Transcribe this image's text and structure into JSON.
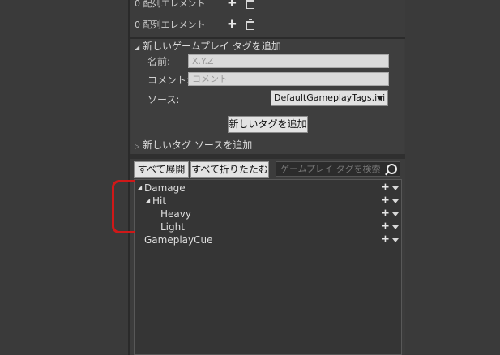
{
  "array_elements": [
    {
      "label": "0 配列エレメント",
      "add_icon": "plus-icon",
      "delete_icon": "trash-icon"
    },
    {
      "label": "0 配列エレメント",
      "add_icon": "plus-icon",
      "delete_icon": "trash-icon"
    }
  ],
  "add_tag_section": {
    "title": "新しいゲームプレイ タグを追加",
    "name_label": "名前:",
    "name_placeholder": "X.Y.Z",
    "comment_label": "コメント:",
    "comment_placeholder": "コメント",
    "source_label": "ソース:",
    "source_value": "DefaultGameplayTags.ini",
    "add_button": "新しいタグを追加"
  },
  "add_source_section": {
    "title": "新しいタグ ソースを追加"
  },
  "toolbar": {
    "expand_all": "すべて展開",
    "collapse_all": "すべて折りたたむ",
    "search_placeholder": "ゲームプレイ タグを検索"
  },
  "tree": [
    {
      "label": "Damage",
      "expanded": true,
      "depth": 0
    },
    {
      "label": "Hit",
      "expanded": true,
      "depth": 1
    },
    {
      "label": "Heavy",
      "depth": 2
    },
    {
      "label": "Light",
      "depth": 2
    },
    {
      "label": "GameplayCue",
      "depth": 0
    }
  ],
  "colors": {
    "annotation": "#d01818",
    "panel": "#3c3c3c",
    "tree_bg": "#353535"
  }
}
